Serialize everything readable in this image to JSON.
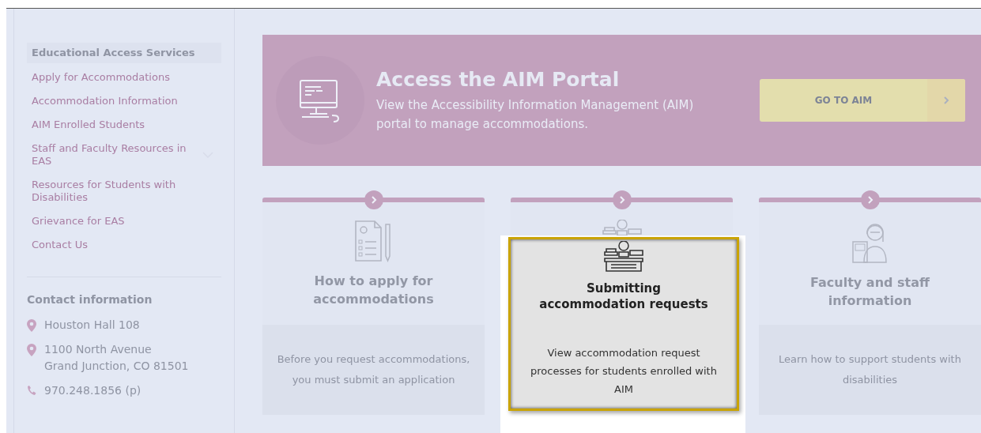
{
  "sidebar": {
    "nav": [
      {
        "label": "Educational Access Services",
        "selected": true,
        "kind": "link"
      },
      {
        "label": "Apply for Accommodations",
        "selected": false,
        "kind": "link"
      },
      {
        "label": "Accommodation Information",
        "selected": false,
        "kind": "link"
      },
      {
        "label": "AIM Enrolled Students",
        "selected": false,
        "kind": "link"
      },
      {
        "label": "Staff and Faculty Resources in EAS",
        "selected": false,
        "kind": "group"
      },
      {
        "label": "Resources for Students with Disabilities",
        "selected": false,
        "kind": "link"
      },
      {
        "label": "Grievance for EAS",
        "selected": false,
        "kind": "link"
      },
      {
        "label": "Contact Us",
        "selected": false,
        "kind": "link"
      }
    ],
    "contact": {
      "heading": "Contact information",
      "items": [
        {
          "kind": "location",
          "lines": [
            "Houston Hall 108"
          ]
        },
        {
          "kind": "location",
          "lines": [
            "1100 North Avenue",
            "Grand Junction, CO 81501"
          ]
        },
        {
          "kind": "phone",
          "lines": [
            "970.248.1856 (p)"
          ]
        }
      ]
    }
  },
  "banner": {
    "title": "Access the AIM Portal",
    "description": "View the Accessibility Information Management (AIM) portal to manage accommodations.",
    "button": "GO TO AIM"
  },
  "cards": [
    {
      "title": "How to apply for accommodations",
      "description": "Before you request accommodations, you must submit an application",
      "highlighted": false
    },
    {
      "title": "Submitting accommodation requests",
      "description": "View accommodation request processes for students enrolled with AIM",
      "highlighted": true
    },
    {
      "title": "Faculty and staff information",
      "description": "Learn how to support students with disabilities",
      "highlighted": false
    }
  ]
}
